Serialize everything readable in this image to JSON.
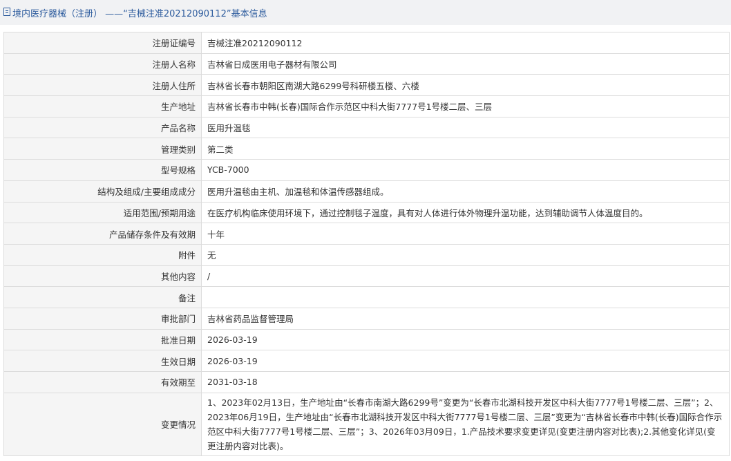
{
  "header": {
    "title": "境内医疗器械（注册）  ——“吉械注准20212090112”基本信息"
  },
  "rows": [
    {
      "label": "注册证编号",
      "value": "吉械注准20212090112"
    },
    {
      "label": "注册人名称",
      "value": "吉林省日成医用电子器材有限公司"
    },
    {
      "label": "注册人住所",
      "value": "吉林省长春市朝阳区南湖大路6299号科研楼五楼、六楼"
    },
    {
      "label": "生产地址",
      "value": "吉林省长春市中韩(长春)国际合作示范区中科大街7777号1号楼二层、三层"
    },
    {
      "label": "产品名称",
      "value": "医用升温毯"
    },
    {
      "label": "管理类别",
      "value": "第二类"
    },
    {
      "label": "型号规格",
      "value": "YCB-7000"
    },
    {
      "label": "结构及组成/主要组成成分",
      "value": "医用升温毯由主机、加温毯和体温传感器组成。"
    },
    {
      "label": "适用范围/预期用途",
      "value": "在医疗机构临床使用环境下，通过控制毯子温度，具有对人体进行体外物理升温功能，达到辅助调节人体温度目的。"
    },
    {
      "label": "产品储存条件及有效期",
      "value": "十年"
    },
    {
      "label": "附件",
      "value": "无"
    },
    {
      "label": "其他内容",
      "value": "/"
    },
    {
      "label": "备注",
      "value": ""
    },
    {
      "label": "审批部门",
      "value": "吉林省药品监督管理局"
    },
    {
      "label": "批准日期",
      "value": "2026-03-19"
    },
    {
      "label": "生效日期",
      "value": "2026-03-19"
    },
    {
      "label": "有效期至",
      "value": "2031-03-18"
    },
    {
      "label": "变更情况",
      "value": "1、2023年02月13日，生产地址由“长春市南湖大路6299号”变更为“长春市北湖科技开发区中科大街7777号1号楼二层、三层”；2、2023年06月19日，生产地址由“长春市北湖科技开发区中科大街7777号1号楼二层、三层”变更为“吉林省长春市中韩(长春)国际合作示范区中科大街7777号1号楼二层、三层”；3、2026年03月09日，1.产品技术要求变更详见(变更注册内容对比表);2.其他变化详见(变更注册内容对比表)。"
    }
  ]
}
